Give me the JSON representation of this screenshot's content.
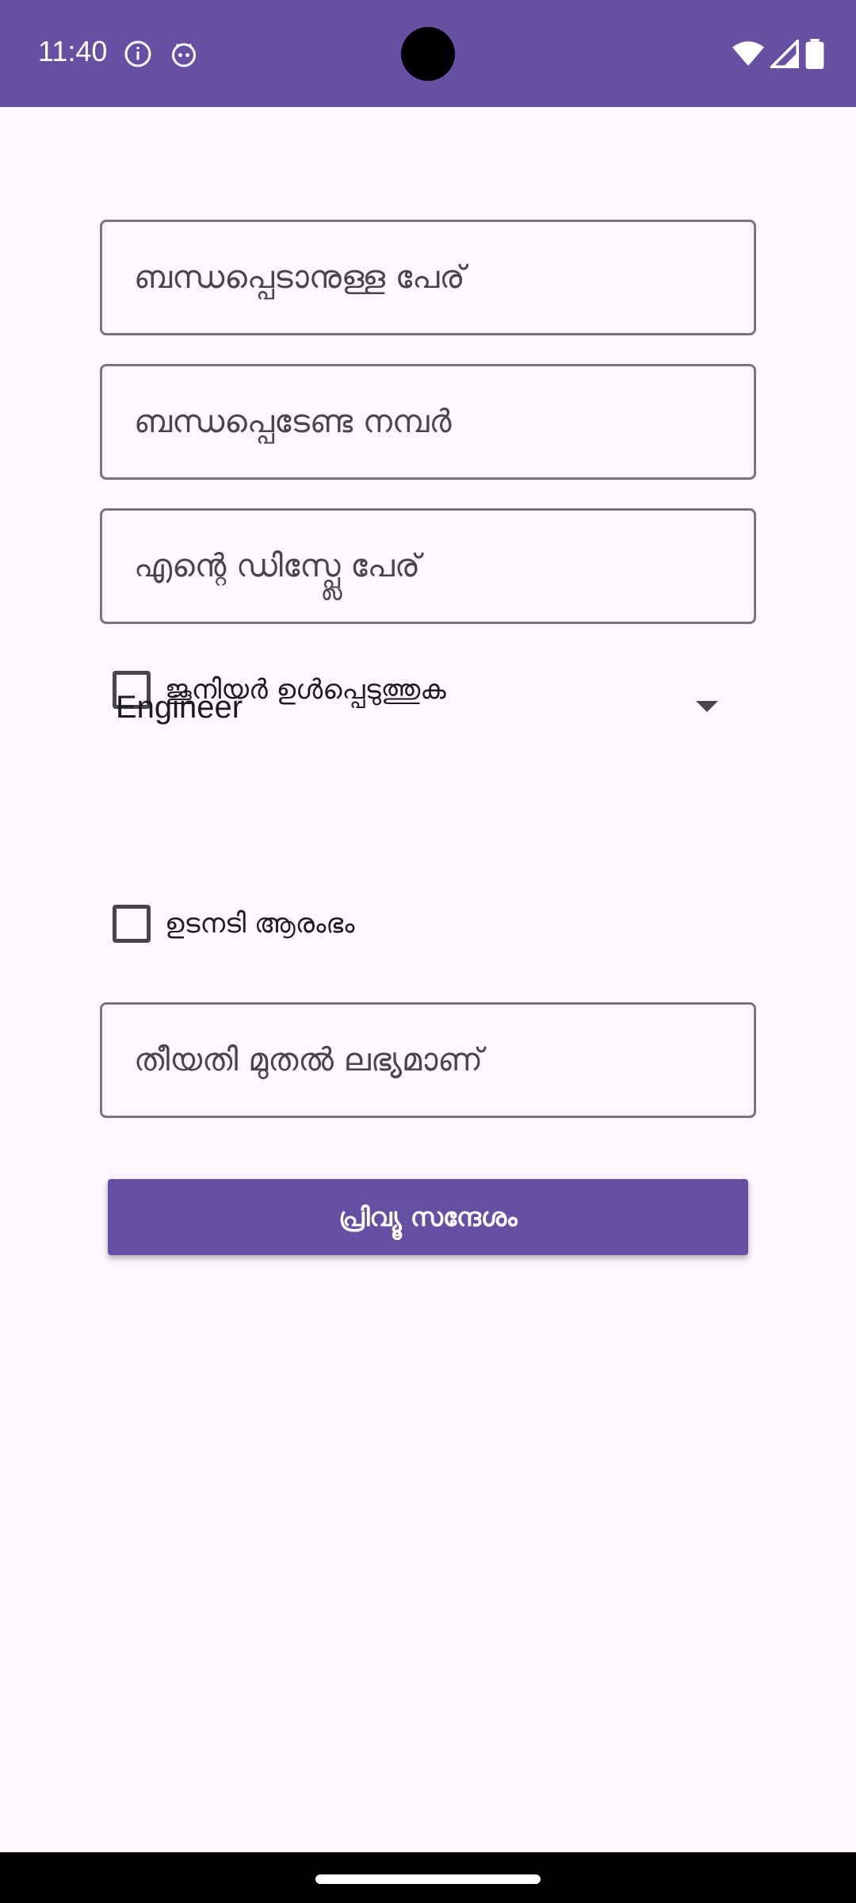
{
  "status_bar": {
    "time": "11:40",
    "icons": [
      "info-icon",
      "android-bot-icon",
      "wifi-icon",
      "cellular-signal-icon",
      "battery-icon"
    ],
    "background": "#6750a4"
  },
  "form": {
    "contact_name_placeholder": "ബന്ധപ്പെടാനുള്ള പേര്",
    "contact_number_placeholder": "ബന്ധപ്പെടേണ്ട നമ്പർ",
    "display_name_placeholder": "എന്റെ ഡിസ്പ്ലേ പേര്",
    "include_junior_label": "ജൂനിയർ ഉൾപ്പെടുത്തുക",
    "include_junior_checked": false,
    "role_selected": "Engineer",
    "immediate_start_label": "ഉടനടി ആരംഭം",
    "immediate_start_checked": false,
    "available_from_placeholder": "തീയതി മുതൽ ലഭ്യമാണ്",
    "preview_button_label": "പ്രിവ്യൂ സന്ദേശം"
  },
  "colors": {
    "accent": "#6750a4",
    "background": "#fdf7fe",
    "outline": "#79747e"
  }
}
